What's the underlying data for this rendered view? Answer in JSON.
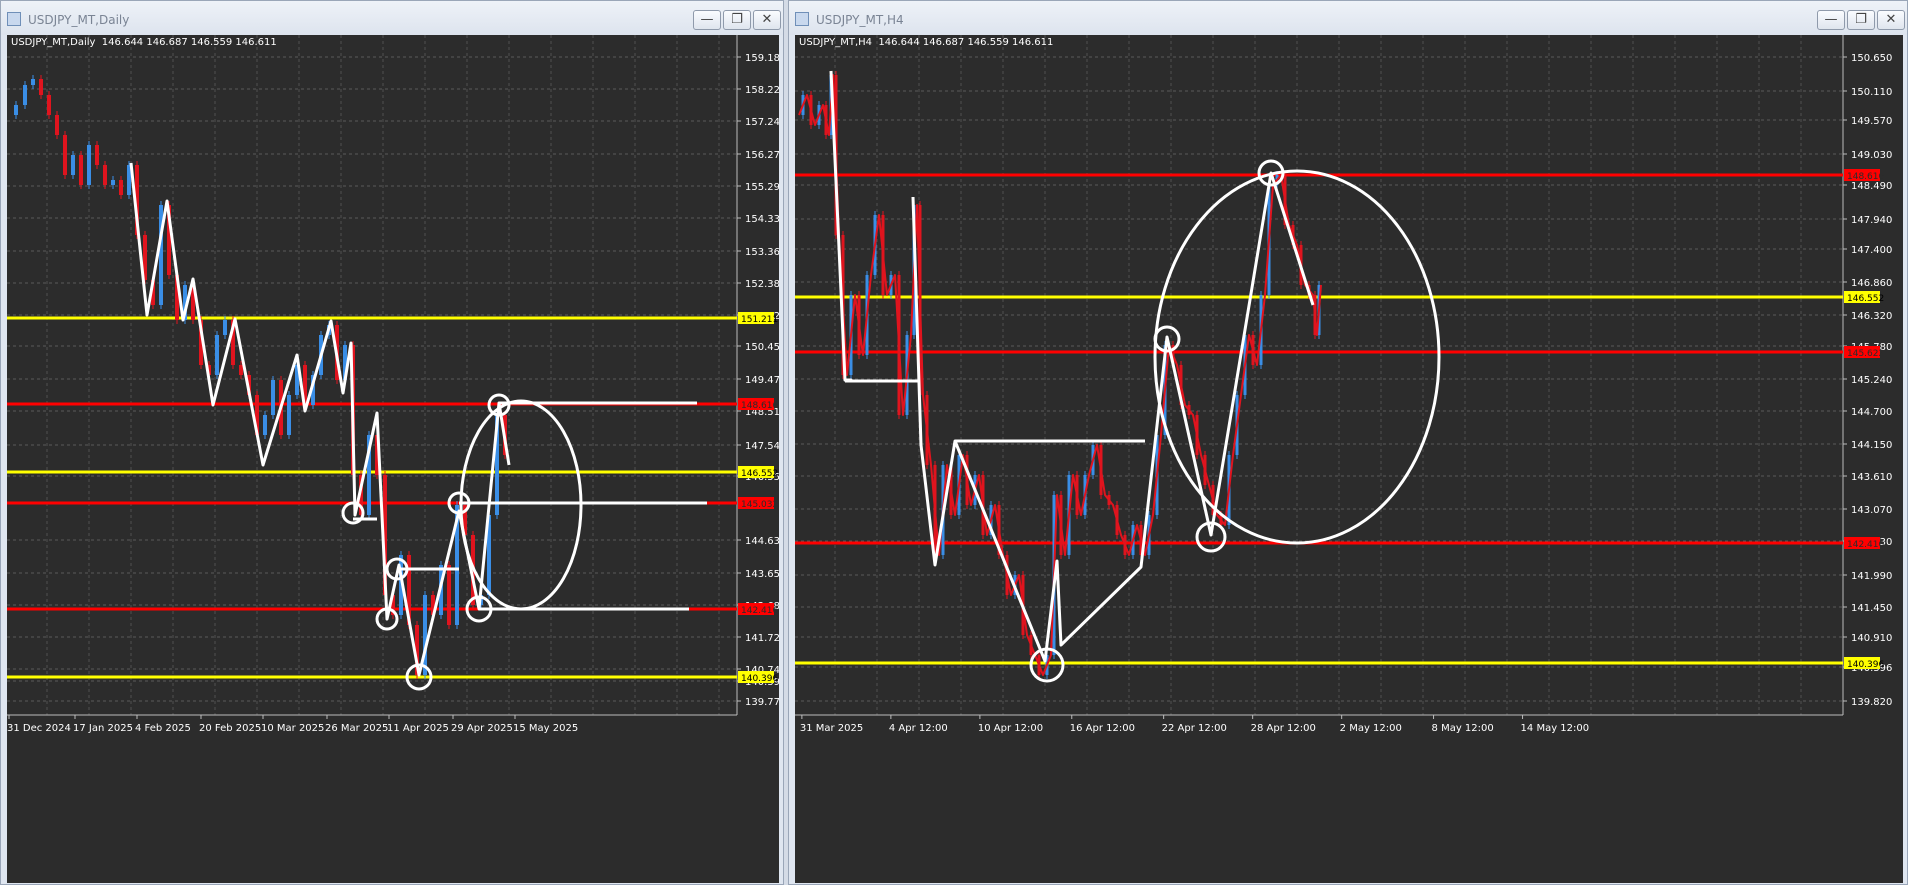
{
  "windows": [
    {
      "title": "USDJPY_MT,Daily",
      "symbol_line": "USDJPY_MT,Daily  146.644 146.687 146.559 146.611",
      "price_labels": [
        "159.180",
        "158.220",
        "157.245",
        "156.270",
        "155.295",
        "154.335",
        "153.360",
        "152.385",
        "151.425",
        "150.450",
        "149.475",
        "148.515",
        "147.540",
        "146.552",
        "144.630",
        "143.655",
        "142.680",
        "141.720",
        "140.745",
        "140.396",
        "139.770"
      ],
      "level_tags": [
        {
          "text": "151.211",
          "color": "#ffff00"
        },
        {
          "text": "148.616",
          "color": "#ff0000"
        },
        {
          "text": "146.552",
          "color": "#ffff00"
        },
        {
          "text": "145.032",
          "color": "#ff0000"
        },
        {
          "text": "142.416",
          "color": "#ff0000"
        },
        {
          "text": "140.396",
          "color": "#ffff00"
        }
      ],
      "date_labels": [
        "31 Dec 2024",
        "17 Jan 2025",
        "4 Feb 2025",
        "20 Feb 2025",
        "10 Mar 2025",
        "26 Mar 2025",
        "11 Apr 2025",
        "29 Apr 2025",
        "15 May 2025"
      ]
    },
    {
      "title": "USDJPY_MT,H4",
      "symbol_line": "USDJPY_MT,H4  146.644 146.687 146.559 146.611",
      "price_labels": [
        "150.650",
        "150.110",
        "149.570",
        "149.030",
        "148.490",
        "147.940",
        "147.400",
        "146.860",
        "146.320",
        "145.780",
        "145.240",
        "144.700",
        "144.150",
        "143.610",
        "143.070",
        "142.530",
        "141.990",
        "141.450",
        "140.910",
        "140.396",
        "139.820"
      ],
      "level_tags": [
        {
          "text": "148.616",
          "color": "#ff0000"
        },
        {
          "text": "146.552",
          "color": "#ffff00"
        },
        {
          "text": "145.622",
          "color": "#ff0000"
        },
        {
          "text": "142.416",
          "color": "#ff0000"
        },
        {
          "text": "140.396",
          "color": "#ffff00"
        }
      ],
      "date_labels": [
        "31 Mar 2025",
        "4 Apr 12:00",
        "10 Apr 12:00",
        "16 Apr 12:00",
        "22 Apr 12:00",
        "28 Apr 12:00",
        "2 May 12:00",
        "8 May 12:00",
        "14 May 12:00"
      ]
    }
  ],
  "colors": {
    "background": "#2c2c2c",
    "bull_candle": "#3a8ee6",
    "bear_candle": "#e0141e",
    "support_line": "#ffff00",
    "resistance_line": "#ff0000",
    "drawings": "#ffffff"
  }
}
